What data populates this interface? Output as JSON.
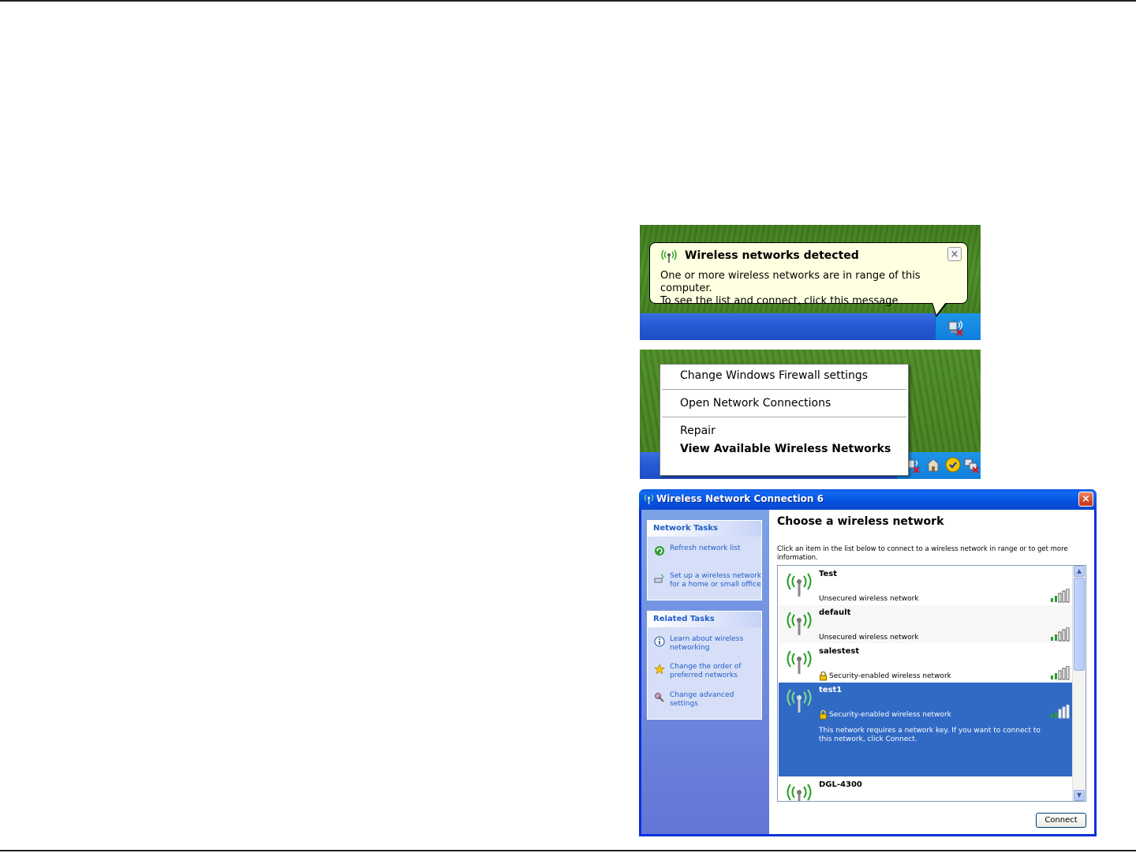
{
  "balloon": {
    "title": "Wireless networks detected",
    "body_line1": "One or more wireless networks are in range of this computer.",
    "body_line2": "To see the list and connect, click this message",
    "close_glyph": "×"
  },
  "context_menu": {
    "items": [
      {
        "label": "Change Windows Firewall settings"
      },
      {
        "label": "Open Network Connections"
      },
      {
        "label": "Repair"
      },
      {
        "label": "View Available Wireless Networks",
        "bold": true
      }
    ]
  },
  "window": {
    "title": "Wireless Network Connection 6",
    "close_glyph": "×",
    "network_tasks": {
      "header": "Network Tasks",
      "items": [
        {
          "line1": "Refresh network list",
          "line2": "",
          "icon": "refresh-icon"
        },
        {
          "line1": "Set up a wireless network",
          "line2": "for a home or small office",
          "icon": "setup-wireless-icon"
        }
      ]
    },
    "related_tasks": {
      "header": "Related Tasks",
      "items": [
        {
          "line1": "Learn about wireless",
          "line2": "networking",
          "icon": "info-icon"
        },
        {
          "line1": "Change the order of",
          "line2": "preferred networks",
          "icon": "star-icon"
        },
        {
          "line1": "Change advanced",
          "line2": "settings",
          "icon": "settings-icon"
        }
      ]
    },
    "heading": "Choose a wireless network",
    "instructions": "Click an item in the list below to connect to a wireless network in range or to get more information.",
    "networks": [
      {
        "ssid": "Test",
        "security": "Unsecured wireless network",
        "secured": false,
        "selected": false,
        "signal_bars": 4
      },
      {
        "ssid": "default",
        "security": "Unsecured wireless network",
        "secured": false,
        "selected": false,
        "signal_bars": 4
      },
      {
        "ssid": "salestest",
        "security": "Security-enabled wireless network",
        "secured": true,
        "selected": false,
        "signal_bars": 4
      },
      {
        "ssid": "test1",
        "security": "Security-enabled wireless network",
        "secured": true,
        "selected": true,
        "signal_bars": 4,
        "note": "This network requires a network key. If you want to connect to this network, click Connect."
      },
      {
        "ssid": "DGL-4300",
        "security": "",
        "secured": false,
        "selected": false,
        "signal_bars": 4
      }
    ],
    "connect_label": "Connect"
  },
  "colors": {
    "selection": "#316ac5",
    "title_bar": "#0453e0",
    "balloon_bg": "#ffffe1",
    "task_link": "#215dc6"
  }
}
